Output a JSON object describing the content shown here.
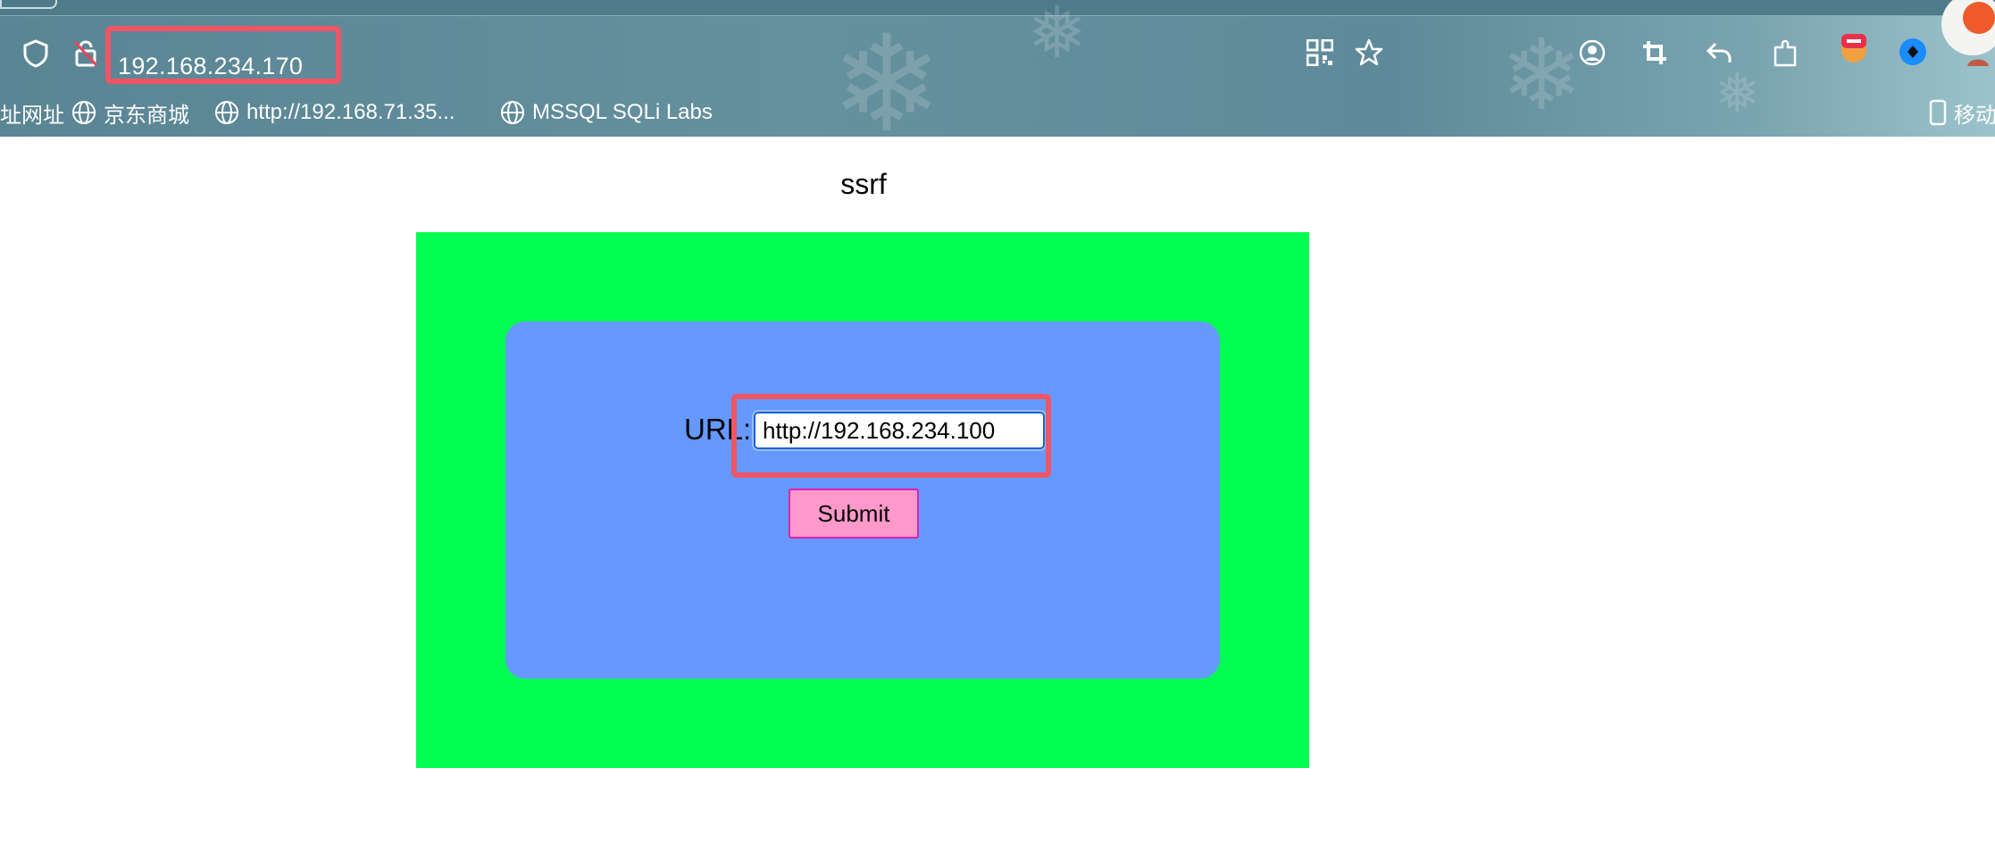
{
  "browser": {
    "address": "192.168.234.170",
    "bookmarks": [
      {
        "label": "址网址"
      },
      {
        "label": "京东商城"
      },
      {
        "label": "http://192.168.71.35..."
      },
      {
        "label": "MSSQL SQLi Labs"
      }
    ],
    "mobile_label": "移动",
    "toolbar_icons": [
      "shield-icon",
      "insecure-lock-icon",
      "qr-code-icon",
      "star-icon",
      "account-icon",
      "crop-icon",
      "undo-icon",
      "extensions-icon",
      "adblock-extension-icon",
      "extension-icon",
      "profile-avatar-icon"
    ],
    "colors": {
      "chrome": "#5f8a99",
      "highlight": "#ee5565"
    }
  },
  "page": {
    "title": "ssrf",
    "form": {
      "url_label": "URL:",
      "url_value": "http://192.168.234.100",
      "submit_label": "Submit"
    },
    "colors": {
      "outer_box": "#00ff52",
      "inner_box": "#6699ff",
      "button": "#ff99cc"
    }
  }
}
